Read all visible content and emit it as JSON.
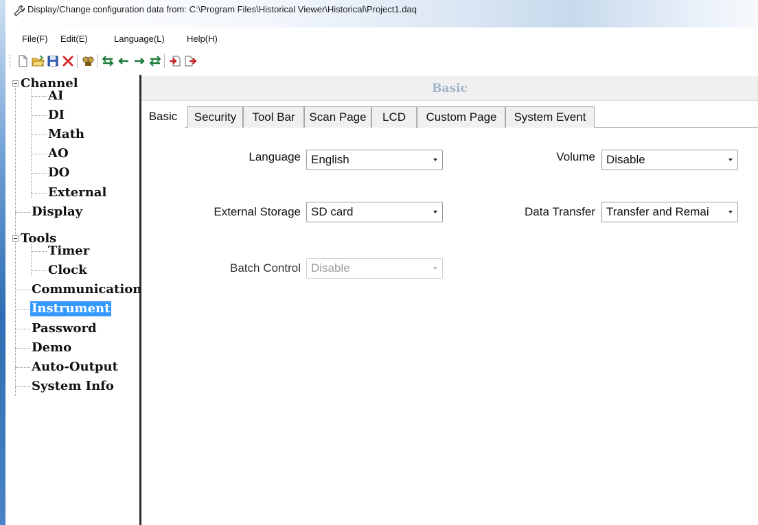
{
  "window": {
    "title": "Display/Change configuration data from: C:\\Program Files\\Historical Viewer\\Historical\\Project1.daq",
    "icon": "wrench-icon"
  },
  "menu": [
    "File(F)",
    "Edit(E)",
    "Language(L)",
    "Help(H)"
  ],
  "toolbar": {
    "icons": [
      "new-file-icon",
      "open-folder-icon",
      "save-icon",
      "delete-icon",
      "find-icon",
      "move-first-icon",
      "move-left-icon",
      "move-right-icon",
      "move-last-icon",
      "import-icon",
      "export-icon"
    ]
  },
  "tree": {
    "channel": "Channel",
    "ai": "AI",
    "di": "DI",
    "math": "Math",
    "ao": "AO",
    "do": "DO",
    "external": "External",
    "display": "Display",
    "tools": "Tools",
    "timer": "Timer",
    "clock": "Clock",
    "communication": "Communication",
    "instrument": "Instrument",
    "password": "Password",
    "demo": "Demo",
    "auto_output": "Auto-Output",
    "system_info": "System Info",
    "selected": "Instrument"
  },
  "panel": {
    "title": "Basic"
  },
  "tabs": [
    "Basic",
    "Security",
    "Tool Bar",
    "Scan Page",
    "LCD",
    "Custom Page",
    "System Event"
  ],
  "active_tab": "Basic",
  "form": {
    "language": {
      "label": "Language",
      "value": "English"
    },
    "volume": {
      "label": "Volume",
      "value": "Disable"
    },
    "external_storage": {
      "label": "External Storage",
      "value": "SD card"
    },
    "data_transfer": {
      "label": "Data Transfer",
      "value": "Transfer and Remai"
    },
    "batch_control": {
      "label": "Batch Control",
      "value": "Disable",
      "enabled": false
    }
  },
  "colors": {
    "selection": "#3399ff",
    "header_title": "#9fb3c8",
    "desktop_edge": "#2e6db4"
  }
}
